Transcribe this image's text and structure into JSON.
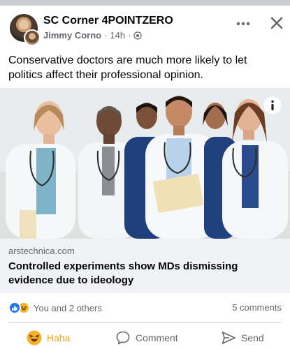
{
  "post": {
    "page_name": "SC Corner 4POINTZERO",
    "author": "Jimmy Corno",
    "separator": "·",
    "time": "14h",
    "separator2": "·",
    "text": "Conservative doctors are much more likely to let politics affect their professional opinion."
  },
  "icons": {
    "more": "more-icon",
    "close": "close-icon",
    "privacy": "globe-icon",
    "info": "info-icon"
  },
  "link": {
    "domain": "arstechnica.com",
    "title": "Controlled experiments show MDs dismissing evidence due to ideology"
  },
  "stats": {
    "reactions_text": "You and 2 others",
    "comments_text": "5 comments"
  },
  "actions": {
    "haha_label": "Haha",
    "comment_label": "Comment",
    "send_label": "Send"
  },
  "colors": {
    "like": "#1877f2",
    "haha": "#f7b125",
    "haha_text": "#e9a21a",
    "secondary_text": "#65676b",
    "link_bg": "#f0f2f5"
  }
}
